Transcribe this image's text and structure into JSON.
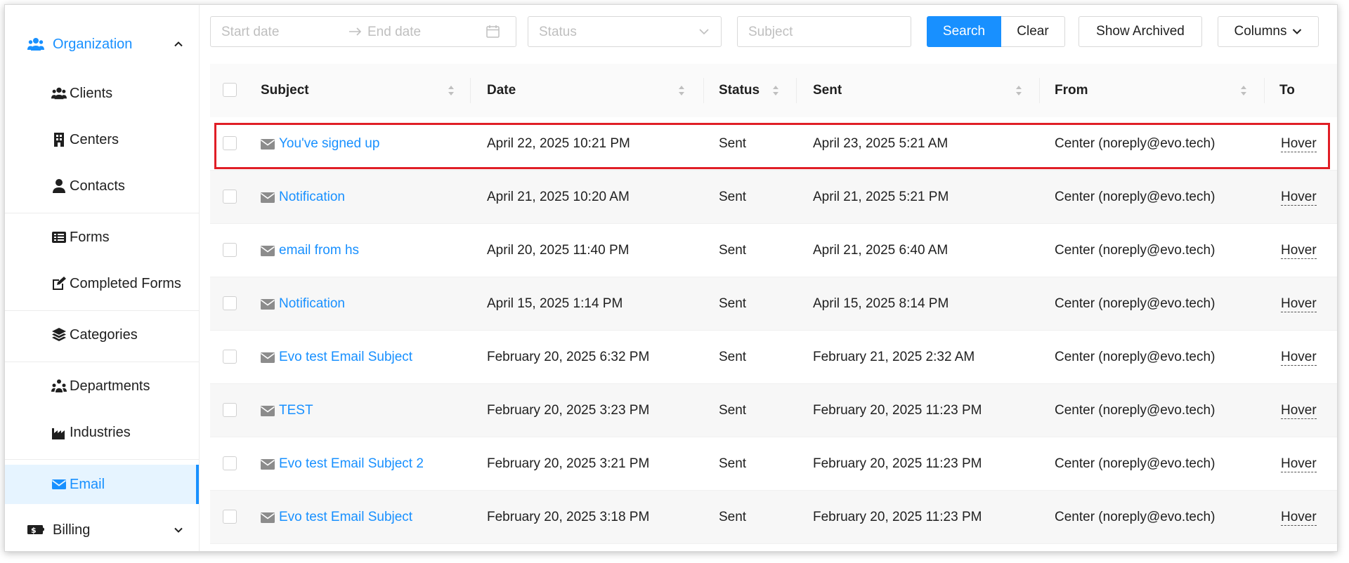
{
  "sidebar": {
    "organization": {
      "label": "Organization",
      "icon": "users-icon"
    },
    "items": [
      {
        "label": "Clients",
        "icon": "users-icon"
      },
      {
        "label": "Centers",
        "icon": "building-icon"
      },
      {
        "label": "Contacts",
        "icon": "user-icon"
      },
      {
        "label": "Forms",
        "icon": "list-icon"
      },
      {
        "label": "Completed Forms",
        "icon": "edit-icon"
      },
      {
        "label": "Categories",
        "icon": "layers-icon"
      },
      {
        "label": "Departments",
        "icon": "departments-icon"
      },
      {
        "label": "Industries",
        "icon": "industry-icon"
      },
      {
        "label": "Email",
        "icon": "envelope-icon",
        "active": true
      }
    ],
    "billing": {
      "label": "Billing",
      "icon": "money-icon"
    }
  },
  "toolbar": {
    "start_date_placeholder": "Start date",
    "end_date_placeholder": "End date",
    "status_placeholder": "Status",
    "subject_placeholder": "Subject",
    "search_label": "Search",
    "clear_label": "Clear",
    "show_archived_label": "Show Archived",
    "columns_label": "Columns"
  },
  "table": {
    "columns": [
      "Subject",
      "Date",
      "Status",
      "Sent",
      "From",
      "To"
    ],
    "rows": [
      {
        "subject": "You've signed up",
        "date": "April 22, 2025 10:21 PM",
        "status": "Sent",
        "sent": "April 23, 2025 5:21 AM",
        "from": "Center (noreply@evo.tech)",
        "to": "Hover"
      },
      {
        "subject": "Notification",
        "date": "April 21, 2025 10:20 AM",
        "status": "Sent",
        "sent": "April 21, 2025 5:21 PM",
        "from": "Center (noreply@evo.tech)",
        "to": "Hover"
      },
      {
        "subject": "email from hs",
        "date": "April 20, 2025 11:40 PM",
        "status": "Sent",
        "sent": "April 21, 2025 6:40 AM",
        "from": "Center (noreply@evo.tech)",
        "to": "Hover"
      },
      {
        "subject": "Notification",
        "date": "April 15, 2025 1:14 PM",
        "status": "Sent",
        "sent": "April 15, 2025 8:14 PM",
        "from": "Center (noreply@evo.tech)",
        "to": "Hover"
      },
      {
        "subject": "Evo test Email Subject",
        "date": "February 20, 2025 6:32 PM",
        "status": "Sent",
        "sent": "February 21, 2025 2:32 AM",
        "from": "Center (noreply@evo.tech)",
        "to": "Hover"
      },
      {
        "subject": "TEST",
        "date": "February 20, 2025 3:23 PM",
        "status": "Sent",
        "sent": "February 20, 2025 11:23 PM",
        "from": "Center (noreply@evo.tech)",
        "to": "Hover"
      },
      {
        "subject": "Evo test Email Subject 2",
        "date": "February 20, 2025 3:21 PM",
        "status": "Sent",
        "sent": "February 20, 2025 11:23 PM",
        "from": "Center (noreply@evo.tech)",
        "to": "Hover"
      },
      {
        "subject": "Evo test Email Subject",
        "date": "February 20, 2025 3:18 PM",
        "status": "Sent",
        "sent": "February 20, 2025 11:23 PM",
        "from": "Center (noreply@evo.tech)",
        "to": "Hover"
      }
    ]
  },
  "colors": {
    "accent": "#1890ff",
    "highlight": "#e01e26"
  }
}
